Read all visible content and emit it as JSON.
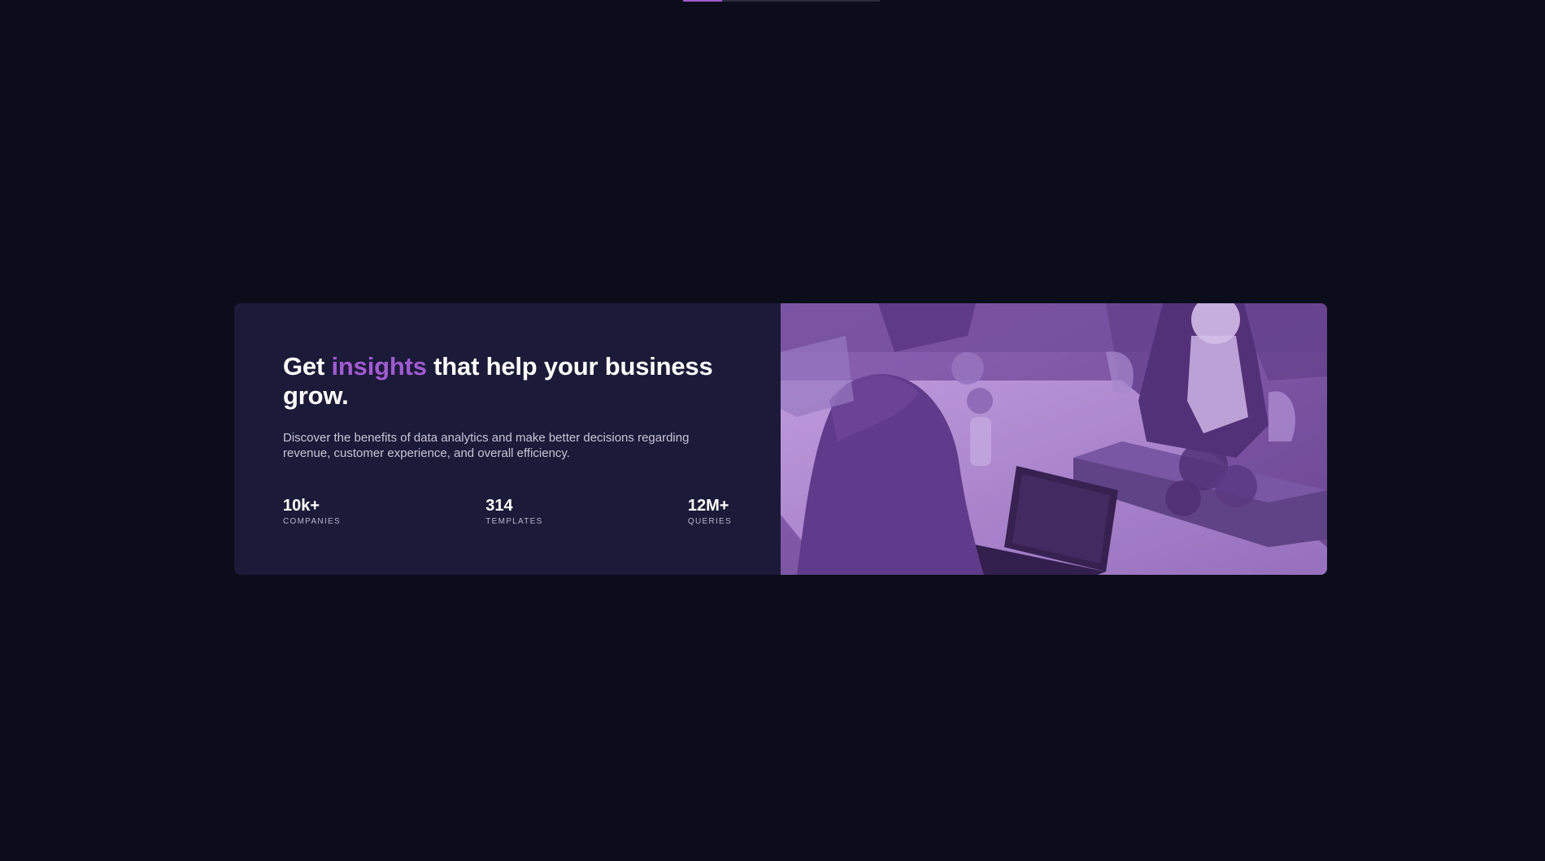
{
  "hero": {
    "headline_prefix": "Get ",
    "headline_accent": "insights",
    "headline_suffix": " that help your business grow.",
    "description": "Discover the benefits of data analytics and make better decisions regarding revenue, customer experience, and overall efficiency.",
    "stats": [
      {
        "value": "10k+",
        "label": "COMPANIES"
      },
      {
        "value": "314",
        "label": "TEMPLATES"
      },
      {
        "value": "12M+",
        "label": "QUERIES"
      }
    ],
    "image_icon": "office-photo-icon"
  },
  "colors": {
    "background": "#0b0d1a",
    "card": "#1b1a38",
    "accent": "#a25ad2",
    "image_tint": "#7e5aa5"
  }
}
